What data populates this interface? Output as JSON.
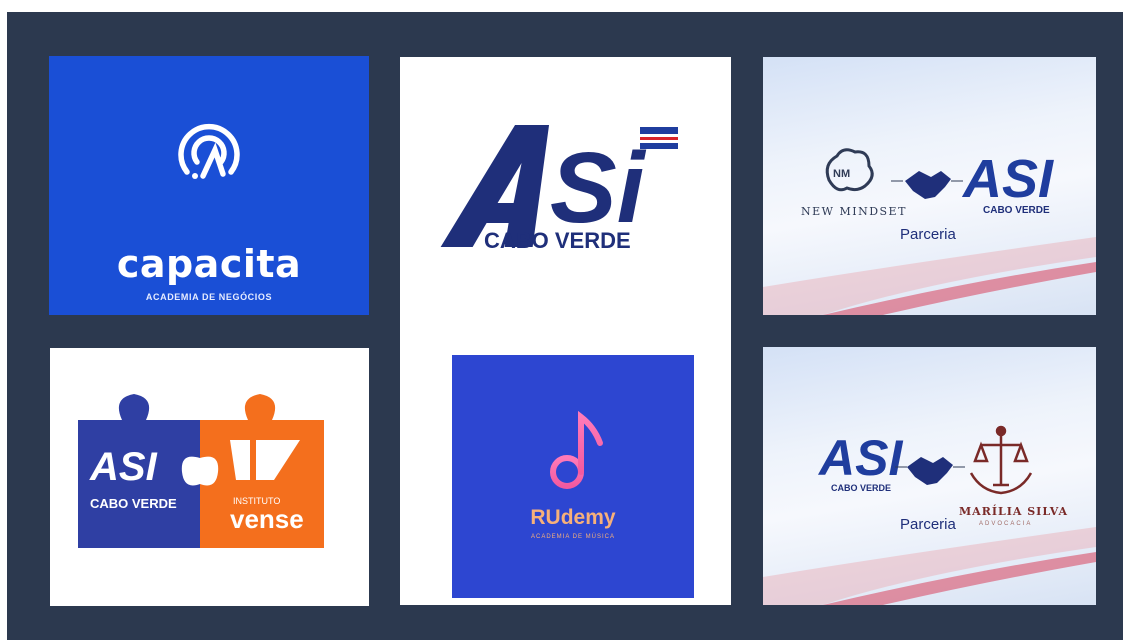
{
  "tiles": {
    "capacita": {
      "name": "capacita",
      "subtitle": "ACADEMIA DE NEGÓCIOS",
      "bg": "#1a4fd6"
    },
    "asi_main": {
      "logo": "ASI",
      "subtitle": "CABO VERDE",
      "color": "#1f2f7a"
    },
    "newmindset": {
      "partner": "NEW MINDSET",
      "partner_mark": "NM",
      "logo": "ASI",
      "logo_sub": "CABO VERDE",
      "caption": "Parceria"
    },
    "puzzle": {
      "left_logo": "ASI",
      "left_sub": "CABO VERDE",
      "right_top": "INSTITUTO",
      "right_name": "vense",
      "left_color": "#2f3fa3",
      "right_color": "#f46f1d"
    },
    "rudemy": {
      "name": "RUdemy",
      "subtitle": "ACADEMIA DE MÚSICA",
      "bg": "#2d46d1"
    },
    "marilia": {
      "logo": "ASI",
      "logo_sub": "CABO VERDE",
      "partner": "MARÍLIA SILVA",
      "partner_sub": "ADVOCACIA",
      "caption": "Parceria"
    }
  }
}
